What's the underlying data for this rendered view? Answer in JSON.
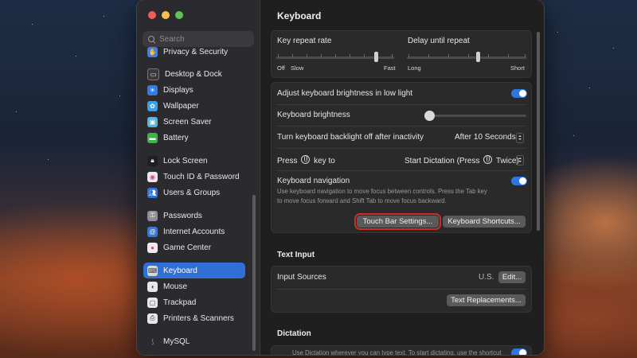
{
  "window": {
    "title": "Keyboard"
  },
  "search": {
    "placeholder": "Search"
  },
  "sidebar": {
    "items": [
      {
        "label": "Privacy & Security",
        "icon": "hand-icon",
        "color": "#3f7ef2"
      },
      {
        "label": "Desktop & Dock",
        "icon": "dock-icon",
        "color": "#3a3a3a"
      },
      {
        "label": "Displays",
        "icon": "sun-icon",
        "color": "#2f7bea"
      },
      {
        "label": "Wallpaper",
        "icon": "flower-icon",
        "color": "#3aa1e6"
      },
      {
        "label": "Screen Saver",
        "icon": "screensaver-icon",
        "color": "#55b6d9"
      },
      {
        "label": "Battery",
        "icon": "battery-icon",
        "color": "#39b54a"
      },
      {
        "label": "Lock Screen",
        "icon": "lock-icon",
        "color": "#1f1f1f"
      },
      {
        "label": "Touch ID & Password",
        "icon": "fingerprint-icon",
        "color": "#e9e9ea"
      },
      {
        "label": "Users & Groups",
        "icon": "users-icon",
        "color": "#2d74da"
      },
      {
        "label": "Passwords",
        "icon": "key-icon",
        "color": "#8e8e93"
      },
      {
        "label": "Internet Accounts",
        "icon": "at-icon",
        "color": "#2e7be6"
      },
      {
        "label": "Game Center",
        "icon": "game-center-icon",
        "color": "#ececec"
      },
      {
        "label": "Keyboard",
        "icon": "keyboard-icon",
        "color": "#d7d7d7"
      },
      {
        "label": "Mouse",
        "icon": "mouse-icon",
        "color": "#e7e7e7"
      },
      {
        "label": "Trackpad",
        "icon": "trackpad-icon",
        "color": "#e7e7e7"
      },
      {
        "label": "Printers & Scanners",
        "icon": "printer-icon",
        "color": "#e7e7e7"
      },
      {
        "label": "MySQL",
        "icon": "mysql-icon",
        "color": "#2b2a2e"
      }
    ],
    "selected": "Keyboard"
  },
  "keyboard": {
    "repeat_rate": {
      "label": "Key repeat rate",
      "left_labels": [
        "Off",
        "Slow"
      ],
      "right_label": "Fast",
      "value_fraction": 0.87
    },
    "delay_repeat": {
      "label": "Delay until repeat",
      "left_label": "Long",
      "right_label": "Short",
      "value_fraction": 0.6
    },
    "adjust_brightness": {
      "label": "Adjust keyboard brightness in low light",
      "on": true
    },
    "brightness": {
      "label": "Keyboard brightness",
      "value_fraction": 0.0
    },
    "backlight_off": {
      "label": "Turn keyboard backlight off after inactivity",
      "value": "After 10 Seconds"
    },
    "press_key": {
      "label_prefix": "Press",
      "label_suffix": "key to",
      "value_prefix": "Start Dictation (Press",
      "value_suffix": "Twice)"
    },
    "navigation": {
      "label": "Keyboard navigation",
      "on": true,
      "description_1": "Use keyboard navigation to move focus between controls. Press the Tab key",
      "description_2": "to move focus forward and Shift Tab to move focus backward."
    },
    "buttons": {
      "touch_bar": "Touch Bar Settings...",
      "shortcuts": "Keyboard Shortcuts..."
    }
  },
  "text_input": {
    "title": "Text Input",
    "input_sources": {
      "label": "Input Sources",
      "value": "U.S.",
      "edit": "Edit..."
    },
    "replacements": "Text Replacements..."
  },
  "dictation": {
    "title": "Dictation",
    "description": "Use Dictation wherever you can type text. To start dictating, use the shortcut"
  },
  "colors": {
    "accent": "#2f6fd6",
    "highlight": "#d12b22"
  }
}
